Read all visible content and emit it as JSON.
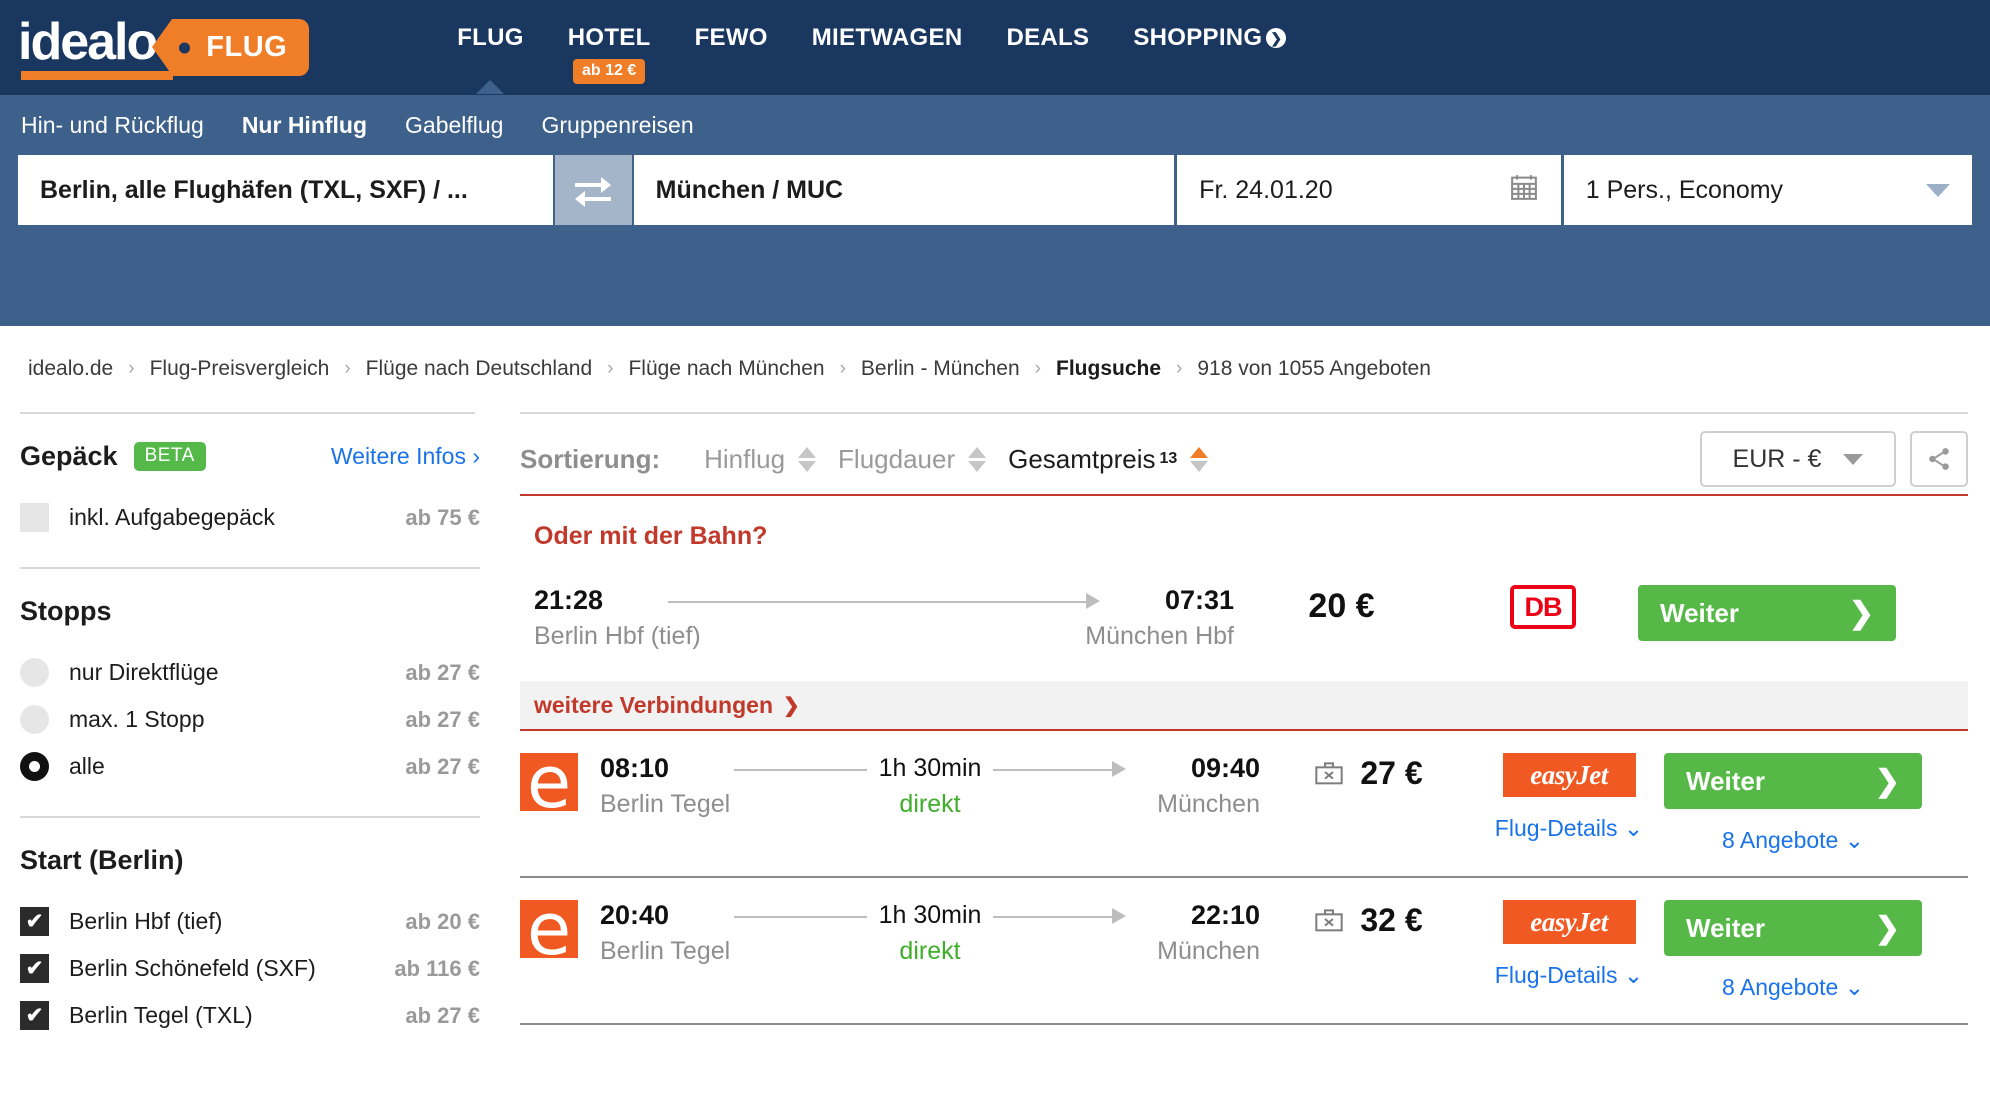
{
  "header": {
    "logo_text": "idealo",
    "logo_tag": "FLUG",
    "nav": [
      {
        "label": "FLUG",
        "active": true,
        "badge": null
      },
      {
        "label": "HOTEL",
        "active": false,
        "badge": "ab 12 €"
      },
      {
        "label": "FEWO",
        "active": false,
        "badge": null
      },
      {
        "label": "MIETWAGEN",
        "active": false,
        "badge": null
      },
      {
        "label": "DEALS",
        "active": false,
        "badge": null
      },
      {
        "label": "SHOPPING",
        "active": false,
        "badge": null
      }
    ],
    "colors": {
      "navy": "#1a3760",
      "band": "#3d618a",
      "orange": "#f07d28"
    }
  },
  "search": {
    "tabs": [
      {
        "label": "Hin- und Rückflug",
        "active": false
      },
      {
        "label": "Nur Hinflug",
        "active": true
      },
      {
        "label": "Gabelflug",
        "active": false
      },
      {
        "label": "Gruppenreisen",
        "active": false
      }
    ],
    "origin": "Berlin, alle Flughäfen (TXL, SXF) / ...",
    "destination": "München / MUC",
    "date": "Fr. 24.01.20",
    "passengers": "1 Pers., Economy",
    "swap_icon": "swap-arrows-icon",
    "calendar_icon": "calendar-icon"
  },
  "breadcrumb": {
    "items": [
      {
        "label": "idealo.de",
        "current": false
      },
      {
        "label": "Flug-Preisvergleich",
        "current": false
      },
      {
        "label": "Flüge nach Deutschland",
        "current": false
      },
      {
        "label": "Flüge nach München",
        "current": false
      },
      {
        "label": "Berlin - München",
        "current": false
      },
      {
        "label": "Flugsuche",
        "current": true
      },
      {
        "label": "918 von 1055 Angeboten",
        "current": false
      }
    ],
    "separator": "›"
  },
  "sidebar": {
    "baggage": {
      "title": "Gepäck",
      "badge": "BETA",
      "link": "Weitere Infos ›",
      "options": [
        {
          "label": "inkl. Aufgabegepäck",
          "price": "ab 75 €",
          "checked": false
        }
      ]
    },
    "stops": {
      "title": "Stopps",
      "options": [
        {
          "label": "nur Direktflüge",
          "price": "ab 27 €",
          "selected": false
        },
        {
          "label": "max. 1 Stopp",
          "price": "ab 27 €",
          "selected": false
        },
        {
          "label": "alle",
          "price": "ab 27 €",
          "selected": true
        }
      ]
    },
    "start": {
      "title": "Start (Berlin)",
      "options": [
        {
          "label": "Berlin Hbf (tief)",
          "price": "ab 20 €",
          "checked": true
        },
        {
          "label": "Berlin Schönefeld (SXF)",
          "price": "ab 116 €",
          "checked": true
        },
        {
          "label": "Berlin Tegel (TXL)",
          "price": "ab 27 €",
          "checked": true
        }
      ]
    },
    "check_glyph": "✔"
  },
  "sortbar": {
    "label": "Sortierung:",
    "options": [
      {
        "label": "Hinflug",
        "active": false,
        "sup": null
      },
      {
        "label": "Flugdauer",
        "active": false,
        "sup": null
      },
      {
        "label": "Gesamtpreis",
        "active": true,
        "sup": "13"
      }
    ],
    "currency": "EUR - €",
    "share_icon": "share-icon"
  },
  "results": {
    "bahn_heading": "Oder mit der Bahn?",
    "more_connections": "weitere Verbindungen",
    "chevron_glyph": "⌄",
    "train": {
      "depart_time": "21:28",
      "depart_place": "Berlin Hbf (tief)",
      "arrive_time": "07:31",
      "arrive_place": "München Hbf",
      "duration": "",
      "price": "20 €",
      "brand": "DB",
      "cta": "Weiter"
    },
    "flights": [
      {
        "airline_logo": "easyjet-e-icon",
        "depart_time": "08:10",
        "depart_place": "Berlin Tegel",
        "duration": "1h 30min",
        "stops": "direkt",
        "arrive_time": "09:40",
        "arrive_place": "München",
        "baggage_icon": "no-checked-baggage-icon",
        "price": "27 €",
        "brand": "easyJet",
        "details_link": "Flug-Details",
        "offers_link": "8 Angebote",
        "cta": "Weiter"
      },
      {
        "airline_logo": "easyjet-e-icon",
        "depart_time": "20:40",
        "depart_place": "Berlin Tegel",
        "duration": "1h 30min",
        "stops": "direkt",
        "arrive_time": "22:10",
        "arrive_place": "München",
        "baggage_icon": "no-checked-baggage-icon",
        "price": "32 €",
        "brand": "easyJet",
        "details_link": "Flug-Details",
        "offers_link": "8 Angebote",
        "cta": "Weiter"
      }
    ]
  }
}
